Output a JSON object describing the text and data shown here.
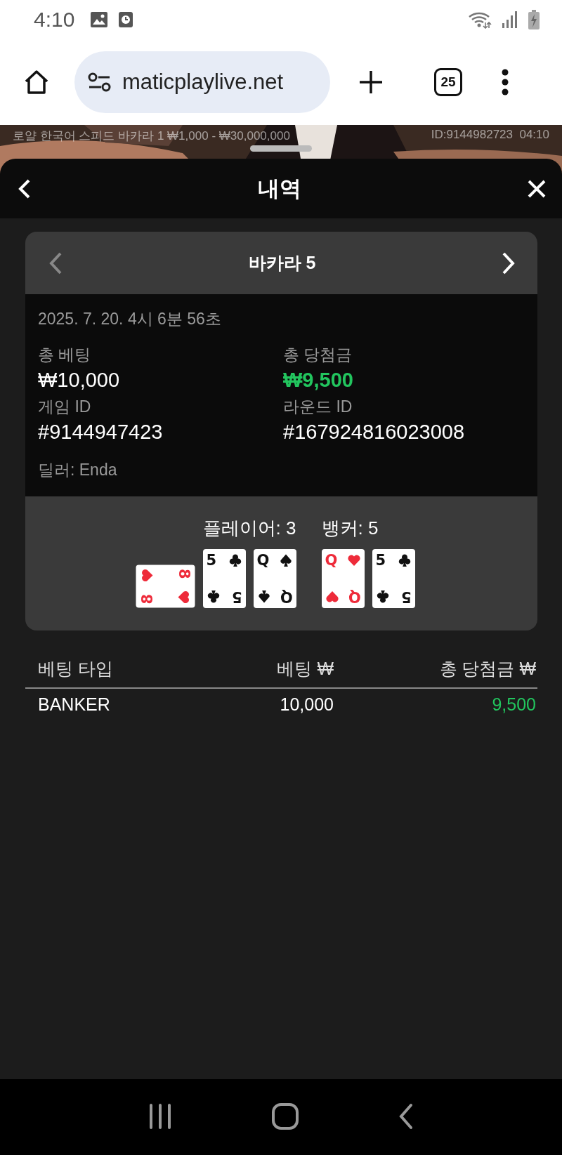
{
  "status_bar": {
    "time": "4:10"
  },
  "browser": {
    "url": "maticplaylive.net",
    "tab_count": "25"
  },
  "stream": {
    "table_info": "로얄 한국어 스피드 바카라 1 ₩1,000 - ₩30,000,000",
    "id_time": "ID:9144982723  04:10"
  },
  "sheet": {
    "title": "내역"
  },
  "round": {
    "title": "바카라 5",
    "prev_disabled": true,
    "next_disabled": false,
    "date": "2025. 7. 20. 4시 6분 56초",
    "fields": [
      {
        "label": "총 베팅",
        "value": "₩10,000",
        "kind": "plain"
      },
      {
        "label": "총 당첨금",
        "value": "₩9,500",
        "kind": "win"
      },
      {
        "label": "게임 ID",
        "value": "#9144947423",
        "kind": "plain"
      },
      {
        "label": "라운드 ID",
        "value": "#167924816023008",
        "kind": "plain"
      }
    ],
    "dealer": "딜러: Enda",
    "hands": [
      {
        "label": "플레이어: 3",
        "cards": [
          {
            "ranks": [
              "8",
              "8"
            ],
            "kind": "hearts",
            "sideways": true
          },
          {
            "ranks": [
              "5",
              "5"
            ],
            "kind": "clubs",
            "sideways": false
          },
          {
            "ranks": [
              "Q",
              "Q"
            ],
            "kind": "spades",
            "sideways": false
          }
        ]
      },
      {
        "label": "뱅커: 5",
        "cards": [
          {
            "ranks": [
              "Q",
              "Q"
            ],
            "kind": "hearts",
            "sideways": false
          },
          {
            "ranks": [
              "5",
              "5"
            ],
            "kind": "clubs",
            "sideways": false
          }
        ]
      }
    ]
  },
  "bets": {
    "columns": [
      "베팅 타입",
      "베팅 ₩",
      "총 당첨금 ₩"
    ],
    "rows": [
      {
        "type": "BANKER",
        "bet": "10,000",
        "win": "9,500"
      }
    ]
  }
}
